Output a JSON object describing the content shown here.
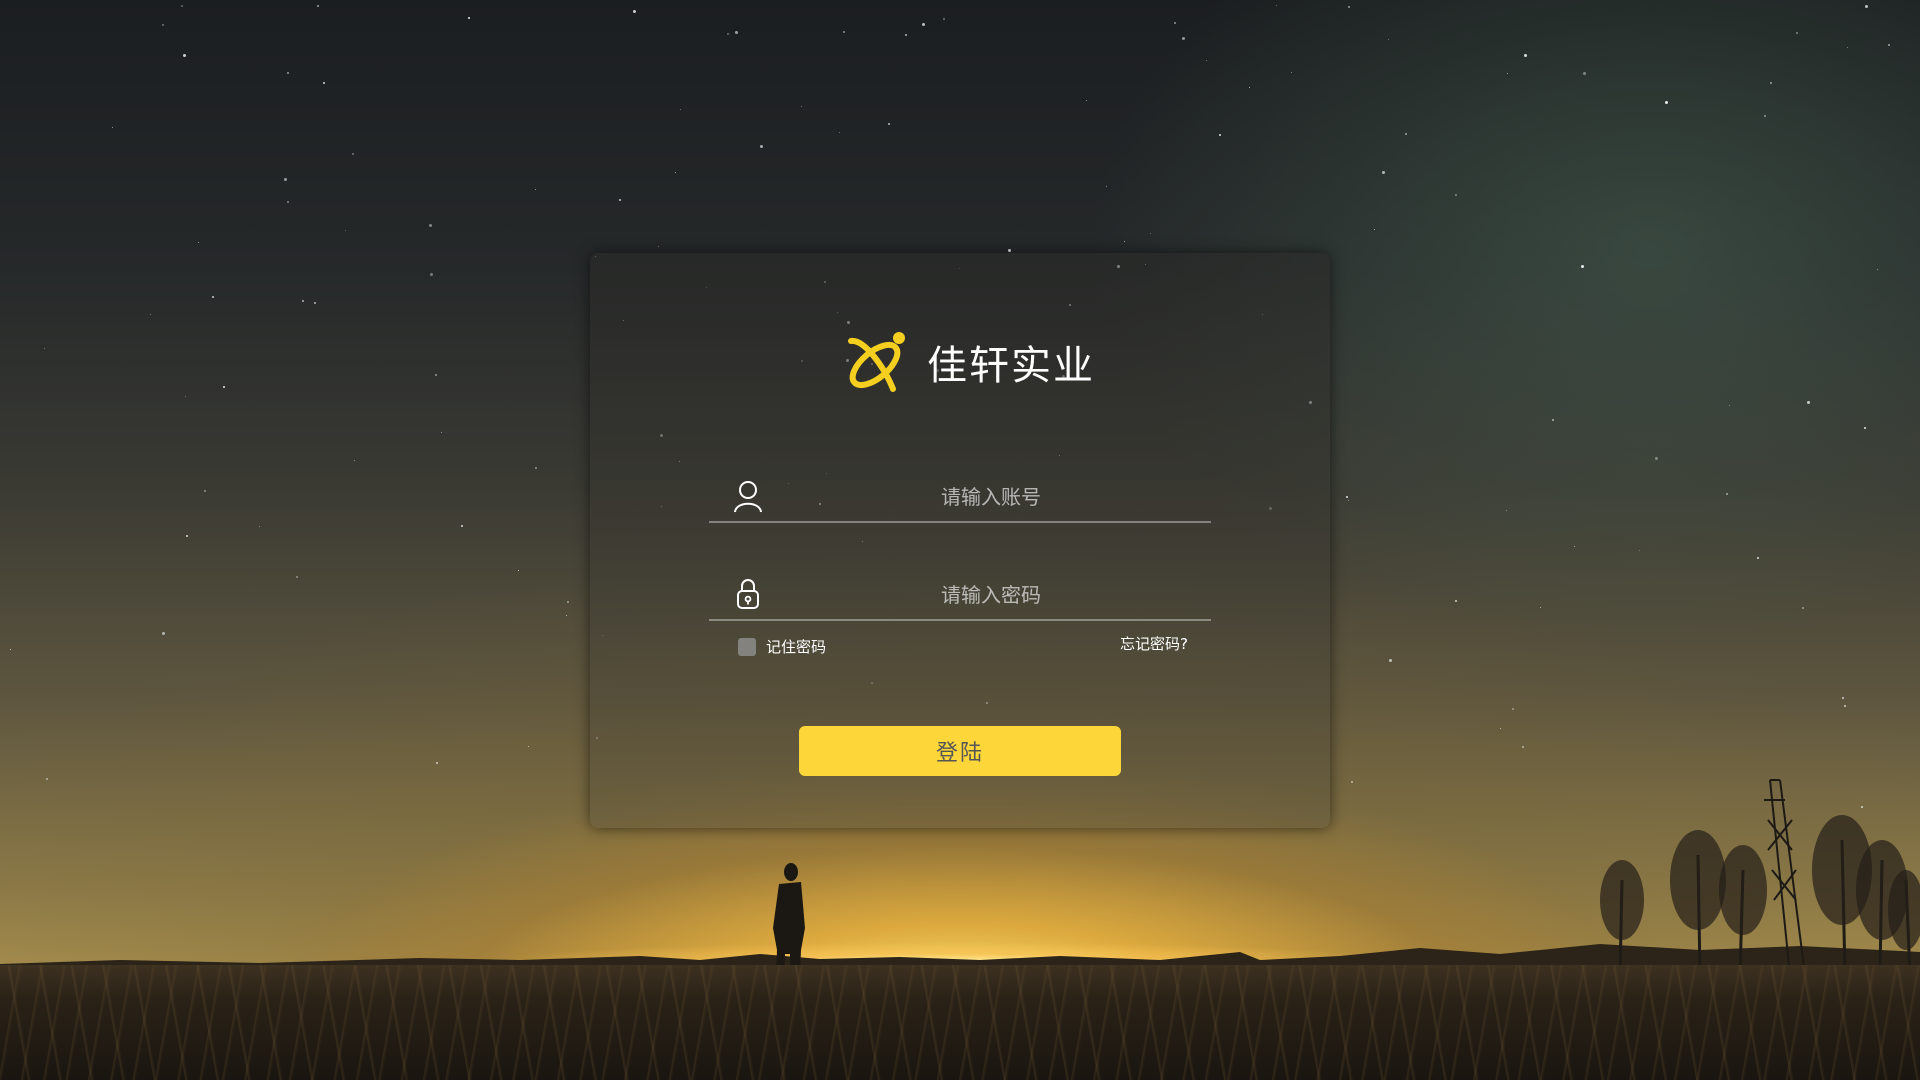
{
  "brand": {
    "name": "佳轩实业",
    "logo_icon": "atom-orbit-logo-icon",
    "logo_color": "#f5cf1f"
  },
  "login_form": {
    "account": {
      "placeholder": "请输入账号",
      "value": "",
      "icon": "user-icon"
    },
    "password": {
      "placeholder": "请输入密码",
      "value": "",
      "icon": "lock-icon"
    },
    "remember": {
      "label": "记住密码",
      "checked": false
    },
    "forgot_label": "忘记密码?",
    "submit_label": "登陆"
  },
  "colors": {
    "accent": "#fdd73a",
    "button_text": "#555555",
    "text": "#ffffff"
  }
}
